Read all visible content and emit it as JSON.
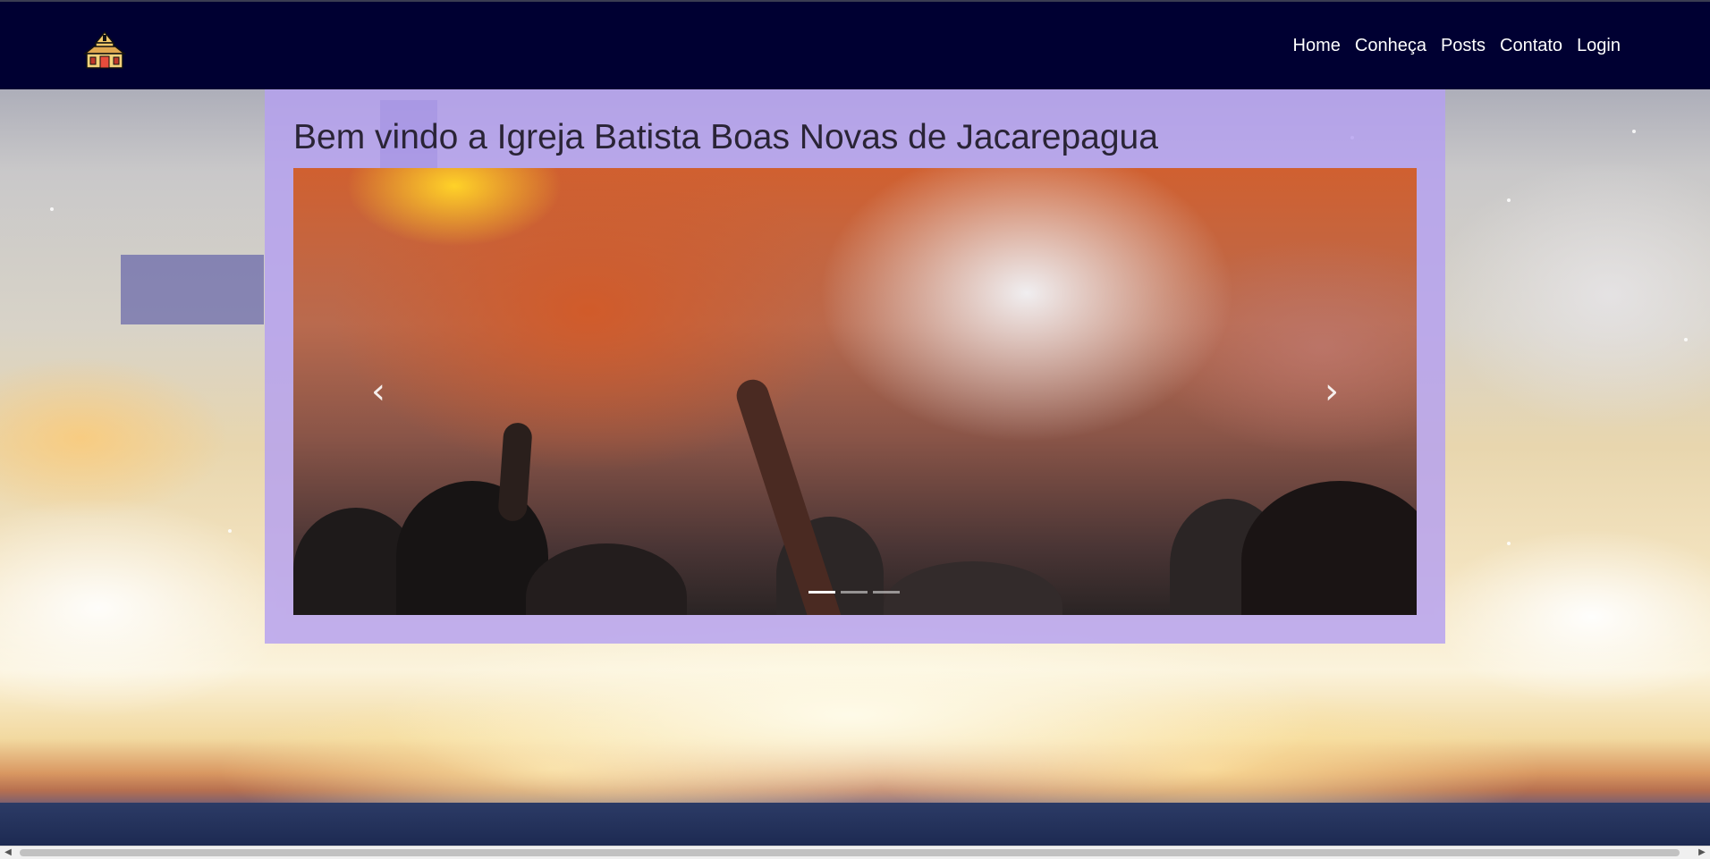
{
  "navbar": {
    "logo_icon": "church-icon",
    "links": [
      {
        "label": "Home"
      },
      {
        "label": "Conheça"
      },
      {
        "label": "Posts"
      },
      {
        "label": "Contato"
      },
      {
        "label": "Login"
      }
    ],
    "background": "#000032"
  },
  "main": {
    "title": "Bem vindo a Igreja Batista Boas Novas de Jacarepagua",
    "carousel": {
      "prev_icon": "chevron-left-icon",
      "next_icon": "chevron-right-icon",
      "slide_count": 3,
      "active_slide": 1
    },
    "panel_color": "#b4a0f0"
  },
  "scrollbar": {
    "left_arrow": "◀",
    "right_arrow": "▶"
  }
}
